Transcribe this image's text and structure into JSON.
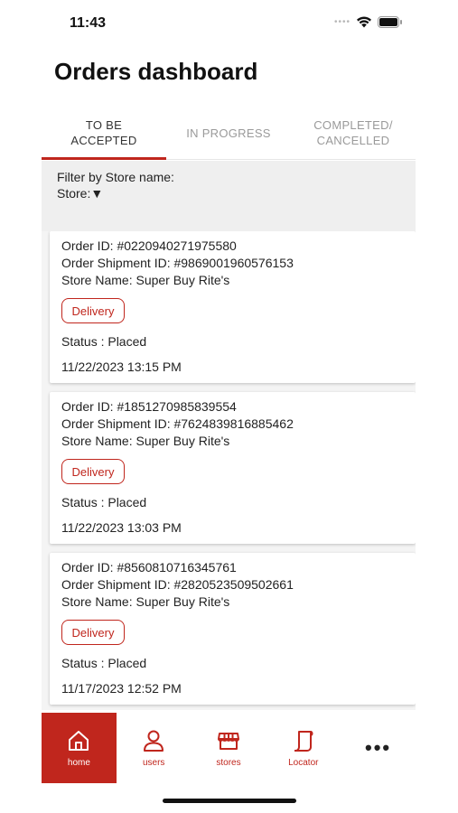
{
  "status_bar": {
    "time": "11:43",
    "signal_icon": "signal-dots-icon",
    "wifi_icon": "wifi-icon",
    "battery_icon": "battery-icon"
  },
  "page": {
    "title": "Orders dashboard"
  },
  "tabs": [
    {
      "label": "TO BE\nACCEPTED",
      "active": true
    },
    {
      "label": "IN PROGRESS",
      "active": false
    },
    {
      "label": "COMPLETED/\nCANCELLED",
      "active": false
    }
  ],
  "filter": {
    "label": "Filter by Store name:",
    "store_label": "Store:▼"
  },
  "orders": [
    {
      "order_id": "Order ID: #0220940271975580",
      "shipment_id": "Order Shipment ID: #9869001960576153",
      "store_name": "Store Name: Super Buy Rite's",
      "type": "Delivery",
      "status": "Status :  Placed",
      "datetime": "11/22/2023 13:15 PM"
    },
    {
      "order_id": "Order ID: #1851270985839554",
      "shipment_id": "Order Shipment ID: #7624839816885462",
      "store_name": "Store Name: Super Buy Rite's",
      "type": "Delivery",
      "status": "Status :  Placed",
      "datetime": "11/22/2023 13:03 PM"
    },
    {
      "order_id": "Order ID: #8560810716345761",
      "shipment_id": "Order Shipment ID: #2820523509502661",
      "store_name": "Store Name: Super Buy Rite's",
      "type": "Delivery",
      "status": "Status :  Placed",
      "datetime": "11/17/2023 12:52 PM"
    }
  ],
  "bottom_nav": {
    "items": [
      {
        "label": "home",
        "icon": "home-icon",
        "active": true
      },
      {
        "label": "users",
        "icon": "user-icon",
        "active": false
      },
      {
        "label": "stores",
        "icon": "store-icon",
        "active": false
      },
      {
        "label": "Locator",
        "icon": "locator-icon",
        "active": false
      }
    ],
    "more": "•••"
  },
  "colors": {
    "accent": "#c0261d",
    "filter_bg": "#efefef",
    "tab_inactive": "#9a9a9a"
  }
}
